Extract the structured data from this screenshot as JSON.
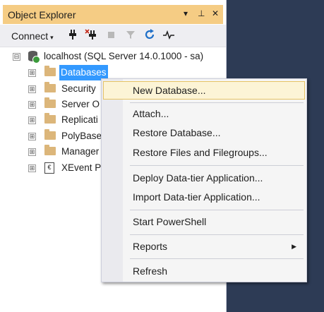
{
  "panel": {
    "title": "Object Explorer",
    "title_buttons": [
      "▾",
      "⊥",
      "✕"
    ],
    "toolbar": {
      "connect_label": "Connect",
      "connect_caret": "▾",
      "icons": [
        "connect-plug-icon",
        "disconnect-plug-icon",
        "stop-icon",
        "filter-icon",
        "refresh-icon",
        "activity-monitor-icon"
      ]
    }
  },
  "tree": {
    "root": {
      "expander": "⊟",
      "label": "localhost (SQL Server 14.0.1000 - sa)"
    },
    "children": [
      {
        "expander": "⊞",
        "label": "Databases",
        "icon": "folder-icon",
        "selected": true
      },
      {
        "expander": "⊞",
        "label": "Security",
        "icon": "folder-icon"
      },
      {
        "expander": "⊞",
        "label": "Server O",
        "icon": "folder-icon"
      },
      {
        "expander": "⊞",
        "label": "Replicati",
        "icon": "folder-icon"
      },
      {
        "expander": "⊞",
        "label": "PolyBase",
        "icon": "folder-icon"
      },
      {
        "expander": "⊞",
        "label": "Manager",
        "icon": "folder-icon"
      },
      {
        "expander": "⊞",
        "label": "XEvent P",
        "icon": "xevent-icon",
        "icon_glyph": "€"
      }
    ]
  },
  "context_menu": {
    "items": [
      {
        "label": "New Database...",
        "highlighted": true
      },
      {
        "label": "Attach..."
      },
      {
        "label": "Restore Database..."
      },
      {
        "label": "Restore Files and Filegroups..."
      },
      {
        "label": "Deploy Data-tier Application..."
      },
      {
        "label": "Import Data-tier Application..."
      },
      {
        "label": "Start PowerShell"
      },
      {
        "label": "Reports",
        "submenu": true,
        "arrow": "▶"
      },
      {
        "label": "Refresh"
      }
    ]
  },
  "colors": {
    "background": "#2d3b55",
    "titlebar": "#f5cc84",
    "selection": "#3399ff",
    "menu_highlight": "#fcf4d6"
  }
}
